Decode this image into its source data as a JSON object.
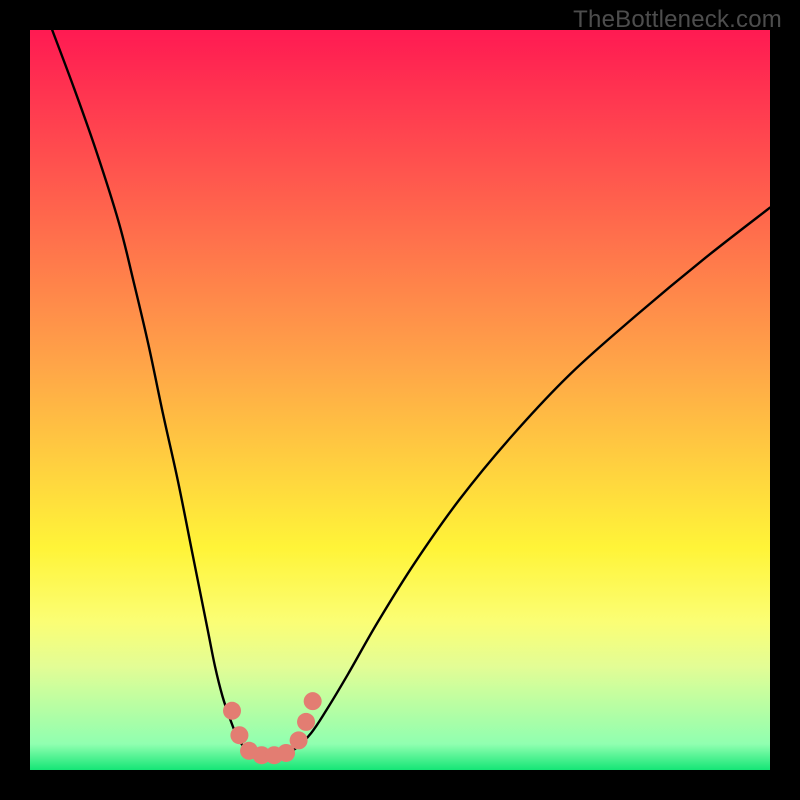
{
  "watermark": "TheBottleneck.com",
  "chart_data": {
    "type": "line",
    "title": "",
    "xlabel": "",
    "ylabel": "",
    "xlim": [
      0,
      100
    ],
    "ylim": [
      0,
      100
    ],
    "background_gradient": {
      "stops": [
        {
          "offset": 0.0,
          "color": "#ff1a52"
        },
        {
          "offset": 0.45,
          "color": "#ffa448"
        },
        {
          "offset": 0.7,
          "color": "#fff438"
        },
        {
          "offset": 0.8,
          "color": "#fbfe75"
        },
        {
          "offset": 0.86,
          "color": "#e3fd95"
        },
        {
          "offset": 0.965,
          "color": "#90ffb0"
        },
        {
          "offset": 1.0,
          "color": "#15e676"
        }
      ]
    },
    "series": [
      {
        "name": "left-branch",
        "x": [
          3,
          6,
          9,
          12,
          14,
          16,
          18,
          20,
          22,
          24,
          25,
          26,
          27,
          28,
          29
        ],
        "y": [
          100,
          92,
          83.5,
          74,
          66,
          57.5,
          48,
          39,
          29,
          19,
          14,
          10,
          7,
          4.5,
          3
        ]
      },
      {
        "name": "right-branch",
        "x": [
          36,
          38,
          40,
          43,
          47,
          52,
          58,
          65,
          73,
          82,
          91,
          100
        ],
        "y": [
          3,
          5,
          8,
          13,
          20,
          28,
          36.5,
          45,
          53.5,
          61.5,
          69,
          76
        ]
      },
      {
        "name": "floor",
        "x": [
          29,
          30,
          31.5,
          33,
          34.5,
          36
        ],
        "y": [
          3,
          2.2,
          2,
          2,
          2.2,
          3
        ]
      }
    ],
    "markers": {
      "color": "#e37d72",
      "radius_px": 9,
      "points": [
        {
          "x": 27.3,
          "y": 8.0
        },
        {
          "x": 28.3,
          "y": 4.7
        },
        {
          "x": 29.6,
          "y": 2.6
        },
        {
          "x": 31.3,
          "y": 2.0
        },
        {
          "x": 33.0,
          "y": 2.0
        },
        {
          "x": 34.6,
          "y": 2.3
        },
        {
          "x": 36.3,
          "y": 4.0
        },
        {
          "x": 37.3,
          "y": 6.5
        },
        {
          "x": 38.2,
          "y": 9.3
        }
      ]
    }
  }
}
